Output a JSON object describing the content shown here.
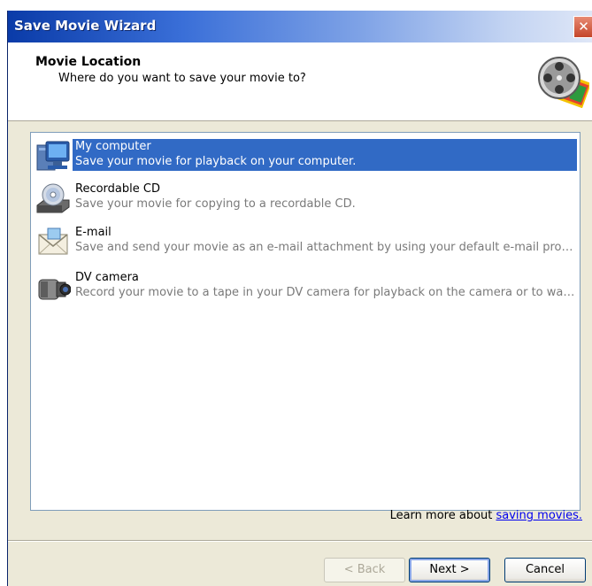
{
  "window": {
    "title": "Save Movie Wizard",
    "close_glyph": "✕"
  },
  "header": {
    "title": "Movie Location",
    "subtitle": "Where do you want to save your movie to?",
    "icon": "film-reel-icon"
  },
  "options": [
    {
      "name": "My computer",
      "description": "Save your movie for playback on your computer.",
      "icon": "computer-icon",
      "selected": true
    },
    {
      "name": "Recordable CD",
      "description": "Save your movie for copying to a recordable CD.",
      "icon": "cd-drive-icon",
      "selected": false
    },
    {
      "name": "E-mail",
      "description": "Save and send your movie as an e-mail attachment by using your default e-mail program.",
      "icon": "email-icon",
      "selected": false
    },
    {
      "name": "DV camera",
      "description": "Record your movie to a tape in your DV camera for playback on the camera or to watch o...",
      "icon": "camcorder-icon",
      "selected": false
    }
  ],
  "learn_more": {
    "prefix": "Learn more about ",
    "link_text": "saving movies."
  },
  "buttons": {
    "back": "< Back",
    "next": "Next >",
    "cancel": "Cancel"
  },
  "colors": {
    "selection": "#316ac5",
    "title_bar": "#0a3ba8",
    "link": "#0000ee"
  }
}
